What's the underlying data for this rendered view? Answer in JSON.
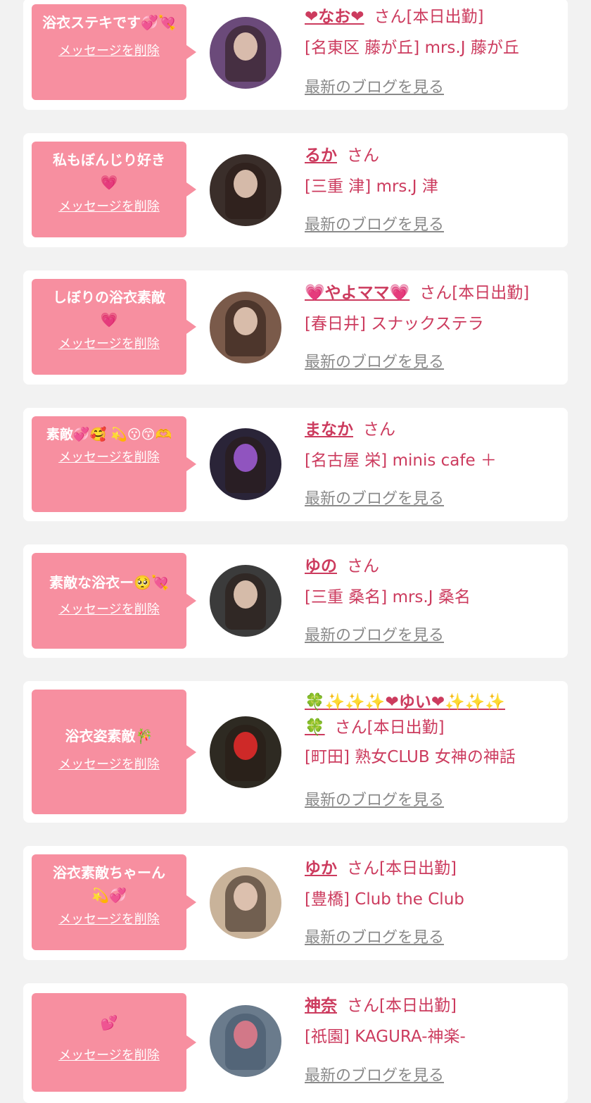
{
  "common": {
    "delete_label": "メッセージを削除",
    "blog_label": "最新のブログを見る"
  },
  "items": [
    {
      "message": "浴衣ステキです",
      "emoji_after": "💞💘",
      "name": "❤なお❤",
      "suffix": "さん[本日出勤]",
      "shop": "[名東区 藤が丘] mrs.J 藤が丘"
    },
    {
      "message": "私もぼんじり好き",
      "emoji_after": "💗",
      "name": "るか",
      "suffix": "さん",
      "shop": "[三重 津] mrs.J 津"
    },
    {
      "message": "しぼりの浴衣素敵",
      "emoji_after": "💗",
      "name": "💗やよママ💗",
      "suffix": "さん[本日出勤]",
      "shop": "[春日井] スナックステラ"
    },
    {
      "message": "素敵",
      "emoji_after": "💞🥰 💫😗😙🫶",
      "name": "まなか",
      "suffix": "さん",
      "shop": "[名古屋 栄] minis cafe ＋"
    },
    {
      "message": "素敵な浴衣ー",
      "emoji_after": "🥺💘",
      "name": "ゆの",
      "suffix": "さん",
      "shop": "[三重 桑名] mrs.J 桑名"
    },
    {
      "message": "浴衣姿素敵",
      "emoji_after": "🎋",
      "name": "🍀✨✨✨❤ゆい❤✨✨✨",
      "name2": "🍀",
      "suffix": "さん[本日出勤]",
      "shop": "[町田] 熟女CLUB 女神の神話"
    },
    {
      "message": "浴衣素敵ちゃーん",
      "emoji_after": "💫💞",
      "name": "ゆか",
      "suffix": "さん[本日出勤]",
      "shop": "[豊橋] Club the Club"
    },
    {
      "message": "",
      "emoji_after": "💕",
      "name": "神奈",
      "suffix": "さん[本日出勤]",
      "shop": "[祇園] KAGURA-神楽-"
    }
  ],
  "avatar_colors": [
    "#6b4a7a",
    "#3a2e2a",
    "#7a5a4a",
    "#2a2438",
    "#3b3b3b",
    "#2e2a22",
    "#c9b39a",
    "#6a7b8c"
  ]
}
